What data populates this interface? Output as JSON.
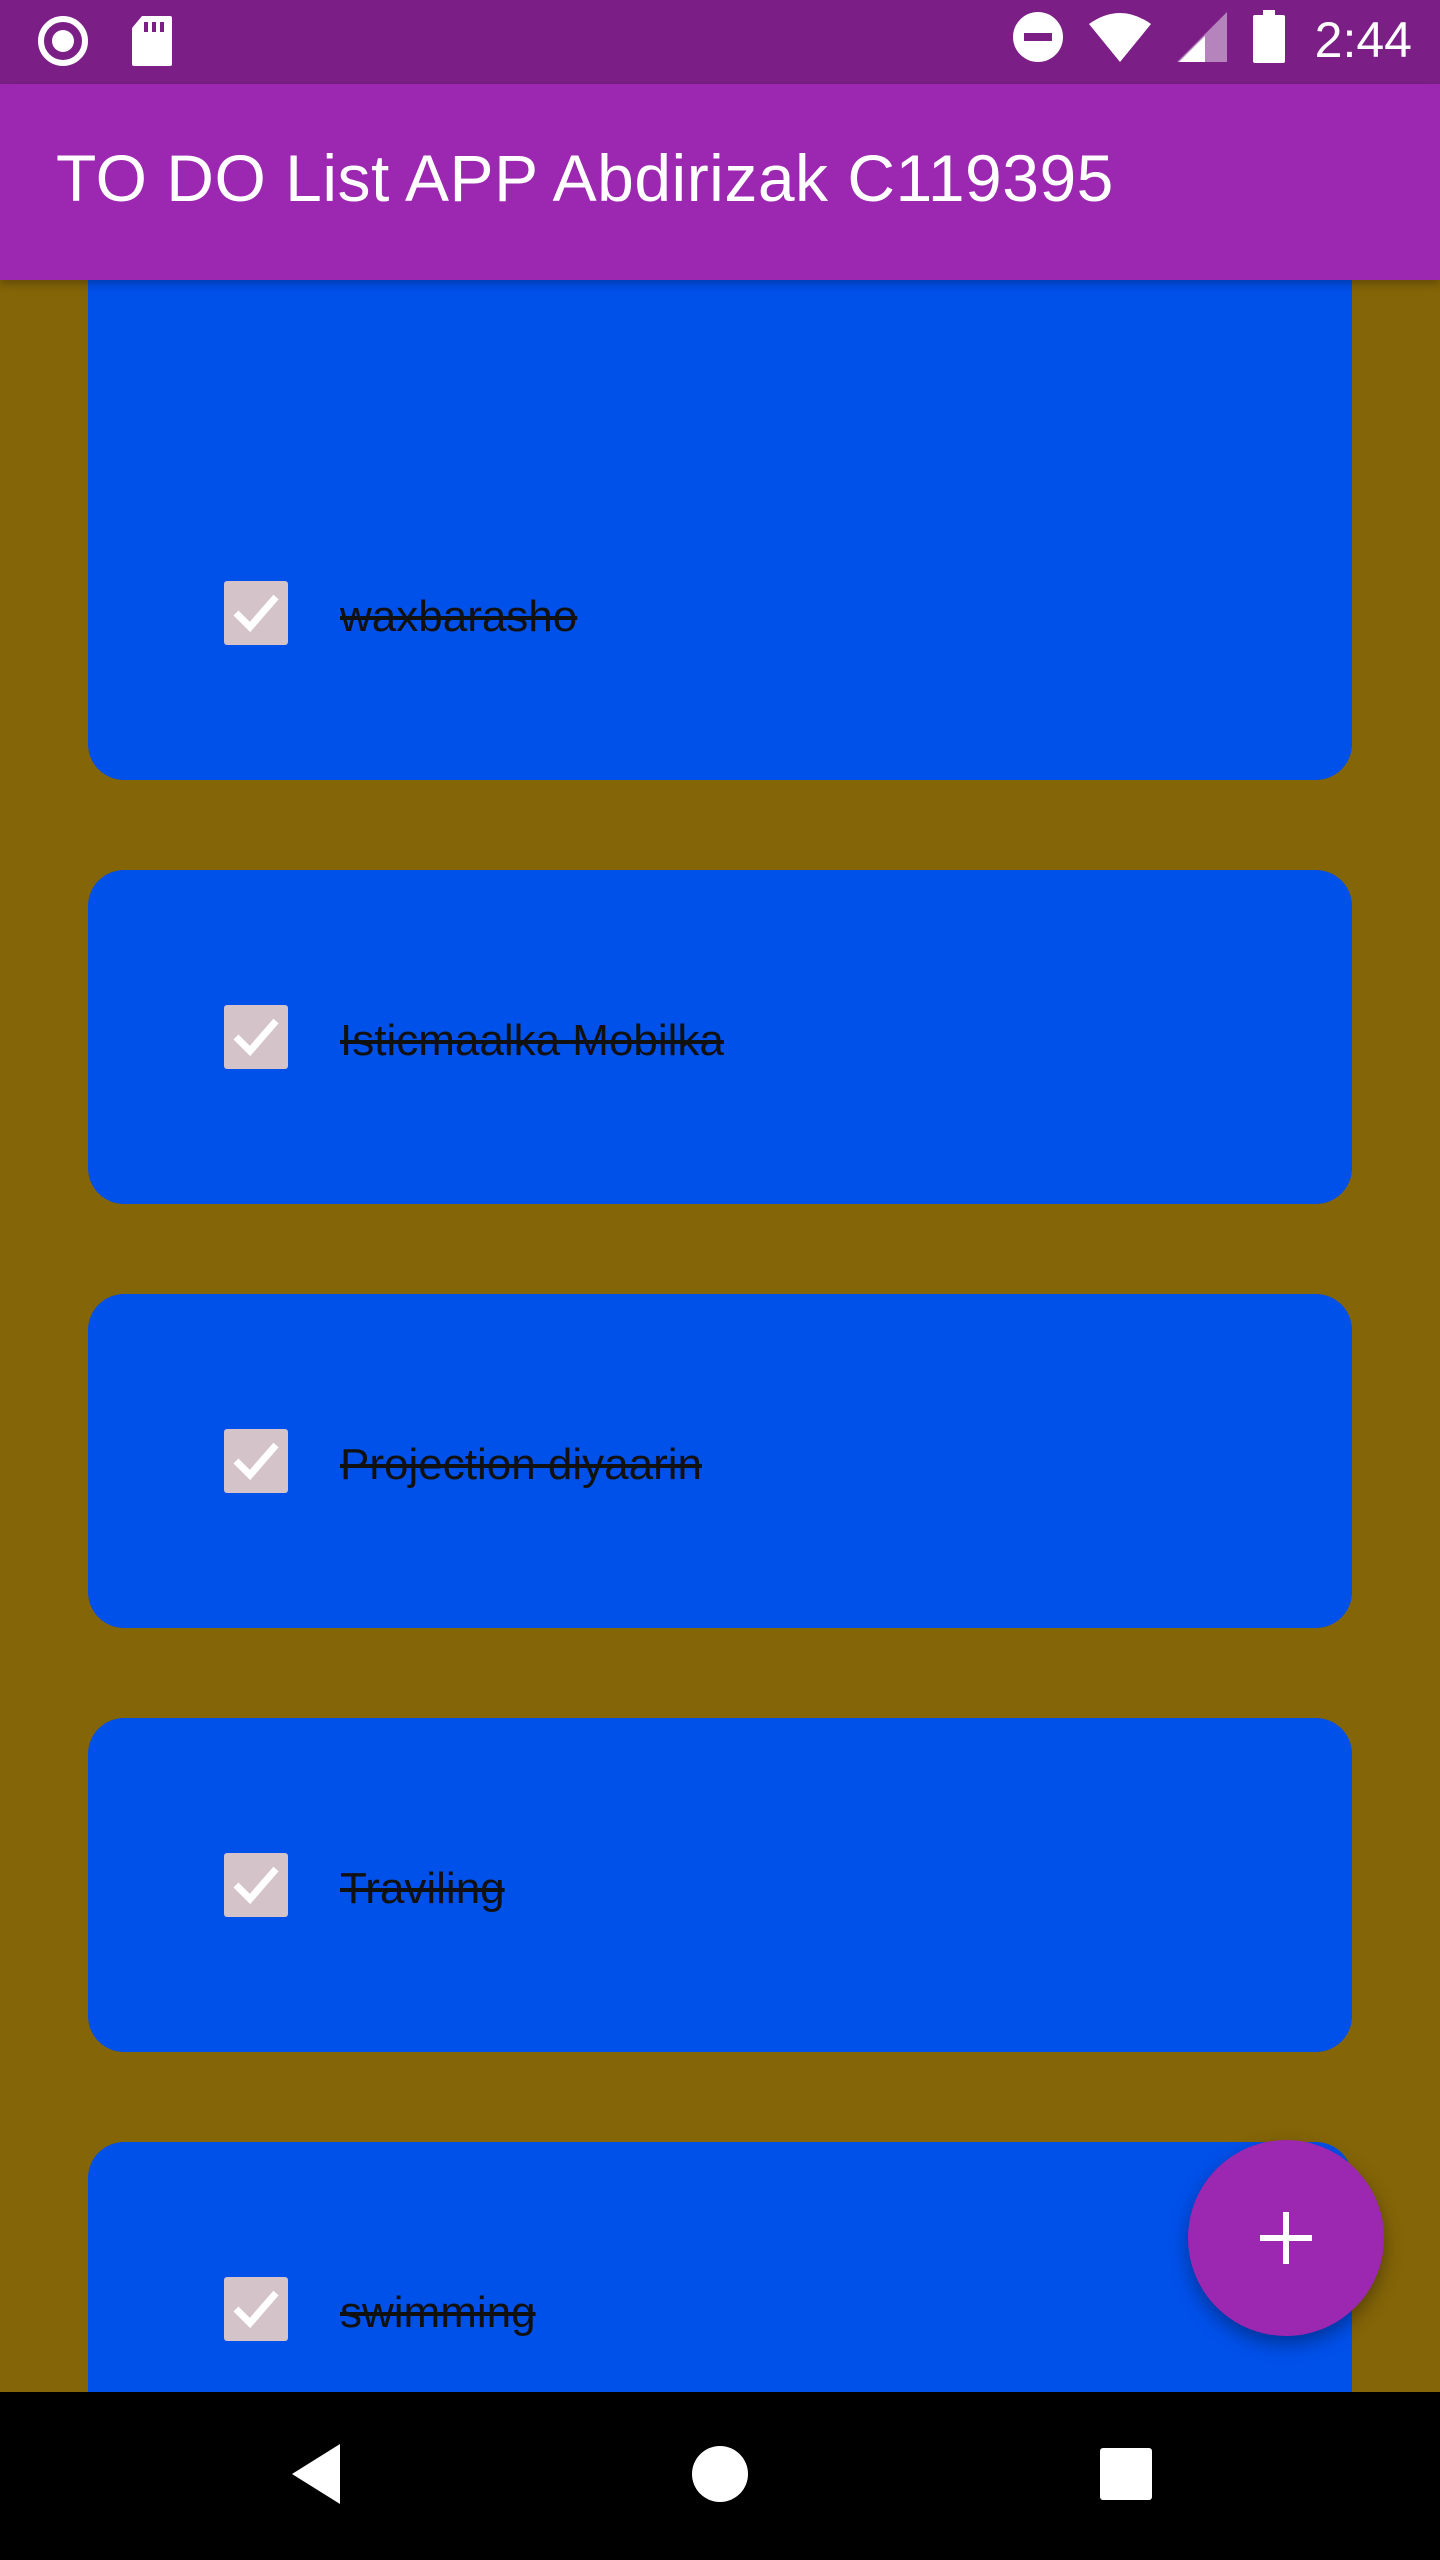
{
  "status_bar": {
    "time": "2:44",
    "icons": [
      "notification-circle-icon",
      "sd-card-icon",
      "do-not-disturb-icon",
      "wifi-icon",
      "cell-signal-icon",
      "battery-icon"
    ]
  },
  "app_bar": {
    "title": "TO DO List APP Abdirizak C119395",
    "color": "#9c27b0"
  },
  "tasks": [
    {
      "label": "",
      "checked": true
    },
    {
      "label": "waxbarasho",
      "checked": true
    },
    {
      "label": "Isticmaalka Mobilka",
      "checked": true
    },
    {
      "label": "Projection diyaarin",
      "checked": true
    },
    {
      "label": "Traviling",
      "checked": true
    },
    {
      "label": "swimming",
      "checked": true
    }
  ],
  "fab": {
    "icon": "plus-icon"
  },
  "nav_bar": {
    "icons": [
      "back-triangle-icon",
      "home-circle-icon",
      "recents-square-icon"
    ]
  },
  "colors": {
    "background": "#846508",
    "card": "#0050ea",
    "status_bar": "#7b1f86",
    "checkbox": "#d4c3c8"
  }
}
